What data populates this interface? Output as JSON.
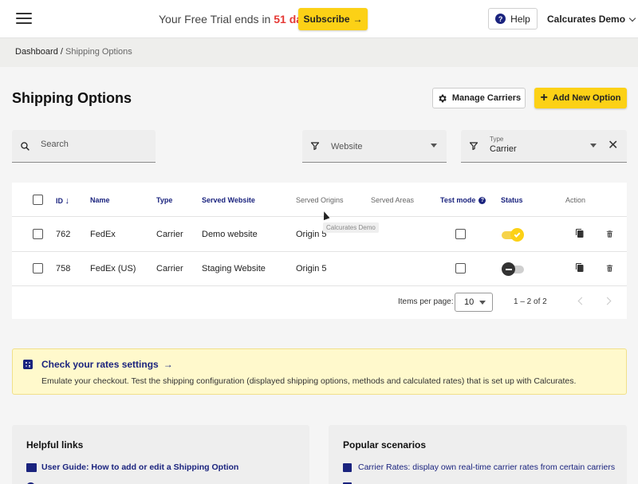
{
  "header": {
    "trial_prefix": "Your Free Trial ends in",
    "trial_days": "51 days",
    "subscribe_label": "Subscribe",
    "help_label": "Help",
    "account_name": "Calcurates Demo"
  },
  "breadcrumb": {
    "root": "Dashboard",
    "separator": " / ",
    "current": "Shipping Options"
  },
  "page": {
    "title": "Shipping Options",
    "manage_carriers_label": "Manage Carriers",
    "add_option_label": "Add New Option"
  },
  "filters": {
    "search_placeholder": "Search",
    "website_placeholder": "Website",
    "type_label": "Type",
    "type_value": "Carrier"
  },
  "table": {
    "columns": {
      "id": "ID",
      "name": "Name",
      "type": "Type",
      "served_website": "Served Website",
      "served_origins": "Served Origins",
      "served_areas": "Served Areas",
      "test_mode": "Test mode",
      "status": "Status",
      "action": "Action"
    },
    "tooltip": "Calcurates Demo",
    "rows": [
      {
        "id": "762",
        "name": "FedEx",
        "type": "Carrier",
        "website": "Demo website",
        "origins": "Origin 5",
        "status_on": true
      },
      {
        "id": "758",
        "name": "FedEx (US)",
        "type": "Carrier",
        "website": "Staging Website",
        "origins": "Origin 5",
        "status_on": false
      }
    ],
    "pager": {
      "items_label": "Items per page:",
      "page_size": "10",
      "range": "1 – 2 of 2"
    }
  },
  "rates": {
    "title": "Check your rates settings",
    "description": "Emulate your checkout. Test the shipping configuration (displayed shipping options, methods and calculated rates) that is set up with Calcurates."
  },
  "helpful_links": {
    "title": "Helpful links",
    "items": [
      "User Guide: How to add or edit a Shipping Option"
    ]
  },
  "popular_scenarios": {
    "title": "Popular scenarios",
    "items": [
      "Carrier Rates: display own real-time carrier rates from certain carriers"
    ]
  },
  "colors": {
    "accent_yellow": "#fcd116",
    "navy": "#1a237e",
    "trial_red": "#e53935",
    "banner_bg": "#fff9cc"
  }
}
